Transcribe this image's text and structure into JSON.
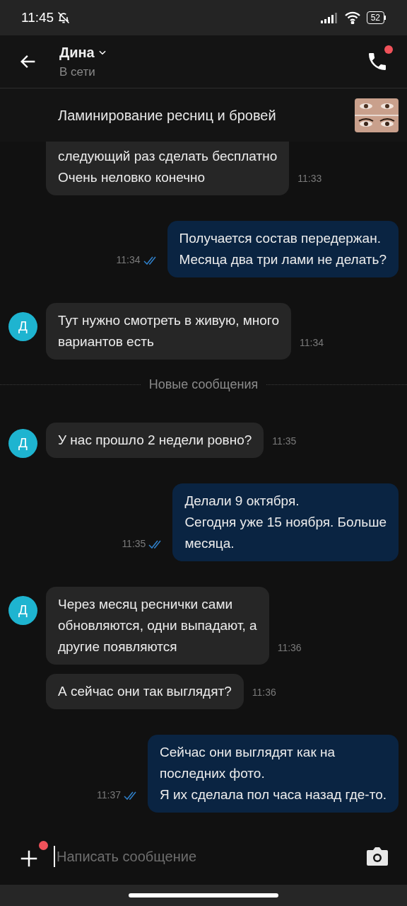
{
  "status_bar": {
    "time": "11:45",
    "battery": "52"
  },
  "header": {
    "name": "Дина",
    "status": "В сети",
    "call_badge": true
  },
  "ad": {
    "title": "Ламинирование ресниц и бровей"
  },
  "messages": [
    {
      "kind": "incoming",
      "avatar": false,
      "clipped": true,
      "text": "следующий раз сделать бесплатно\nОчень неловко конечно",
      "time": "11:33"
    },
    {
      "kind": "outgoing",
      "text": "Получается состав передержан.\nМесяца два три лами не делать?",
      "time": "11:34",
      "read": true
    },
    {
      "kind": "incoming",
      "avatar": true,
      "initial": "Д",
      "text": "Тут нужно смотреть в живую, много\nвариантов есть",
      "time": "11:34"
    },
    {
      "kind": "divider",
      "text": "Новые сообщения"
    },
    {
      "kind": "incoming",
      "avatar": true,
      "initial": "Д",
      "text": "У нас прошло 2 недели ровно?",
      "time": "11:35"
    },
    {
      "kind": "outgoing",
      "text": "Делали 9 октября.\nСегодня уже 15 ноября. Больше\nмесяца.",
      "time": "11:35",
      "read": true
    },
    {
      "kind": "incoming",
      "avatar": true,
      "initial": "Д",
      "text": "Через месяц реснички сами\nобновляются, одни выпадают, а\nдругие появляются",
      "time": "11:36"
    },
    {
      "kind": "incoming",
      "avatar": false,
      "text": "А сейчас они так выглядят?",
      "time": "11:36"
    },
    {
      "kind": "outgoing",
      "text": "Сейчас они выглядят как на\nпоследних фото.\nЯ их сделала пол часа назад где-то.",
      "time": "11:37",
      "read": true
    }
  ],
  "composer": {
    "placeholder": "Написать сообщение",
    "attach_badge": true
  }
}
